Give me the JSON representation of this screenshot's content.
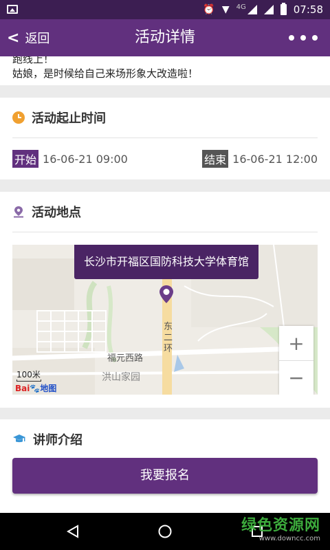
{
  "status_bar": {
    "network": "4G",
    "time": "07:58"
  },
  "header": {
    "back_label": "返回",
    "title": "活动详情"
  },
  "intro": {
    "lines": [
      "跑线上！",
      "姑娘，是时候给自己来场形象大改造啦！"
    ]
  },
  "time_section": {
    "title": "活动起止时间",
    "start_tag": "开始",
    "start_time": "16-06-21 09:00",
    "end_tag": "结束",
    "end_time": "16-06-21 12:00"
  },
  "location_section": {
    "title": "活动地点",
    "map": {
      "bubble": "长沙市开福区国防科技大学体育馆",
      "labels": {
        "road1": "东二环",
        "road2": "福元西路",
        "place": "洪山家园"
      },
      "scale": "100米",
      "logo": "Bai",
      "logo2": "地图"
    }
  },
  "lecturer_section": {
    "title": "讲师介绍"
  },
  "register_button": "我要报名",
  "watermark": {
    "title": "绿色资源网",
    "url": "www.downcc.com"
  },
  "colors": {
    "primary": "#61307e",
    "status": "#3c1e52",
    "clock": "#f0a030",
    "pin": "#6b3d89",
    "hat": "#3a96d6"
  }
}
